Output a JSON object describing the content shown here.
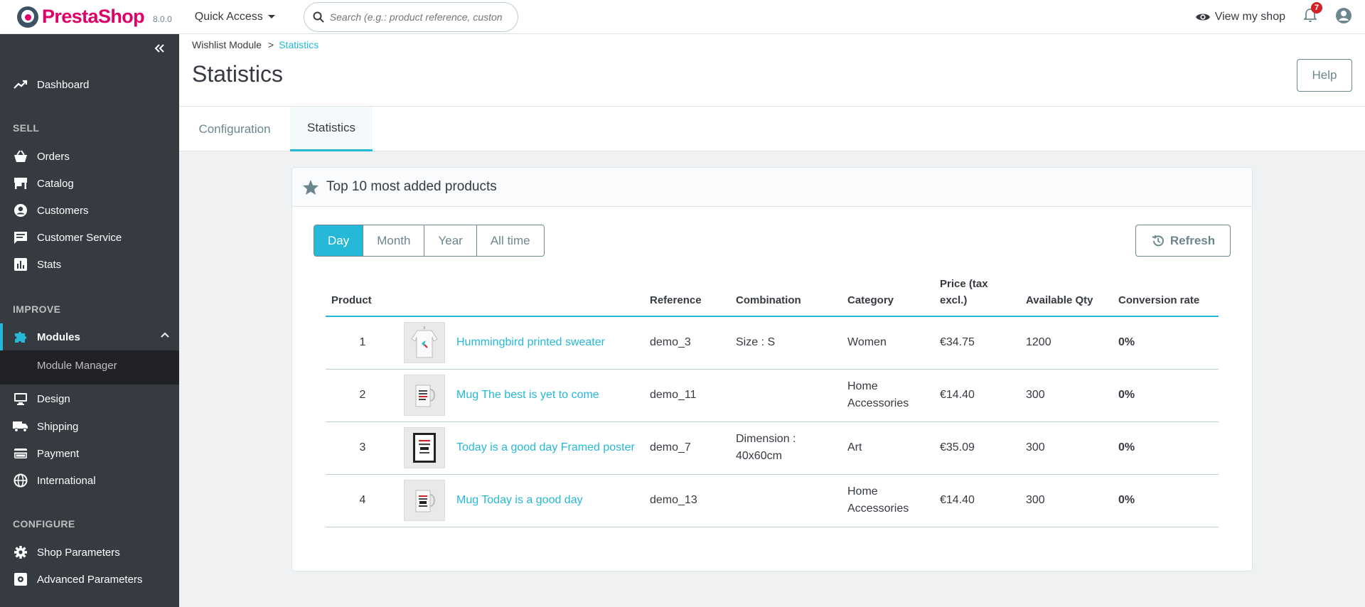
{
  "header": {
    "logo_text": "PrestaShop",
    "version": "8.0.0",
    "quick_access_label": "Quick Access",
    "search_placeholder": "Search (e.g.: product reference, custon",
    "view_shop_label": "View my shop",
    "notifications_count": "7"
  },
  "sidebar": {
    "dashboard": "Dashboard",
    "sections": {
      "sell": "SELL",
      "improve": "IMPROVE",
      "configure": "CONFIGURE"
    },
    "sell_items": [
      "Orders",
      "Catalog",
      "Customers",
      "Customer Service",
      "Stats"
    ],
    "improve_items": {
      "modules": "Modules",
      "module_manager": "Module Manager",
      "design": "Design",
      "shipping": "Shipping",
      "payment": "Payment",
      "international": "International"
    },
    "configure_items": [
      "Shop Parameters",
      "Advanced Parameters"
    ]
  },
  "breadcrumb": {
    "parent": "Wishlist Module",
    "separator": ">",
    "current": "Statistics"
  },
  "page_title": "Statistics",
  "help_label": "Help",
  "tabs": [
    {
      "label": "Configuration",
      "active": false
    },
    {
      "label": "Statistics",
      "active": true
    }
  ],
  "card": {
    "title": "Top 10 most added products",
    "periods": [
      "Day",
      "Month",
      "Year",
      "All time"
    ],
    "active_period": "Day",
    "refresh_label": "Refresh",
    "columns": [
      "Product",
      "Reference",
      "Combination",
      "Category",
      "Price (tax excl.)",
      "Available Qty",
      "Conversion rate"
    ],
    "rows": [
      {
        "rank": "1",
        "image": "sweater-icon",
        "name": "Hummingbird printed sweater",
        "reference": "demo_3",
        "combination": "Size : S",
        "category": "Women",
        "price": "€34.75",
        "qty": "1200",
        "conversion": "0%"
      },
      {
        "rank": "2",
        "image": "mug-icon",
        "name": "Mug The best is yet to come",
        "reference": "demo_11",
        "combination": "",
        "category": "Home Accessories",
        "price": "€14.40",
        "qty": "300",
        "conversion": "0%"
      },
      {
        "rank": "3",
        "image": "poster-icon",
        "name": "Today is a good day Framed poster",
        "reference": "demo_7",
        "combination": "Dimension : 40x60cm",
        "category": "Art",
        "price": "€35.09",
        "qty": "300",
        "conversion": "0%"
      },
      {
        "rank": "4",
        "image": "mug-icon",
        "name": "Mug Today is a good day",
        "reference": "demo_13",
        "combination": "",
        "category": "Home Accessories",
        "price": "€14.40",
        "qty": "300",
        "conversion": "0%"
      }
    ]
  },
  "colors": {
    "accent": "#25b9d7",
    "sidebar_bg": "#363a41",
    "brand": "#df0067",
    "badge": "#d2232a"
  }
}
